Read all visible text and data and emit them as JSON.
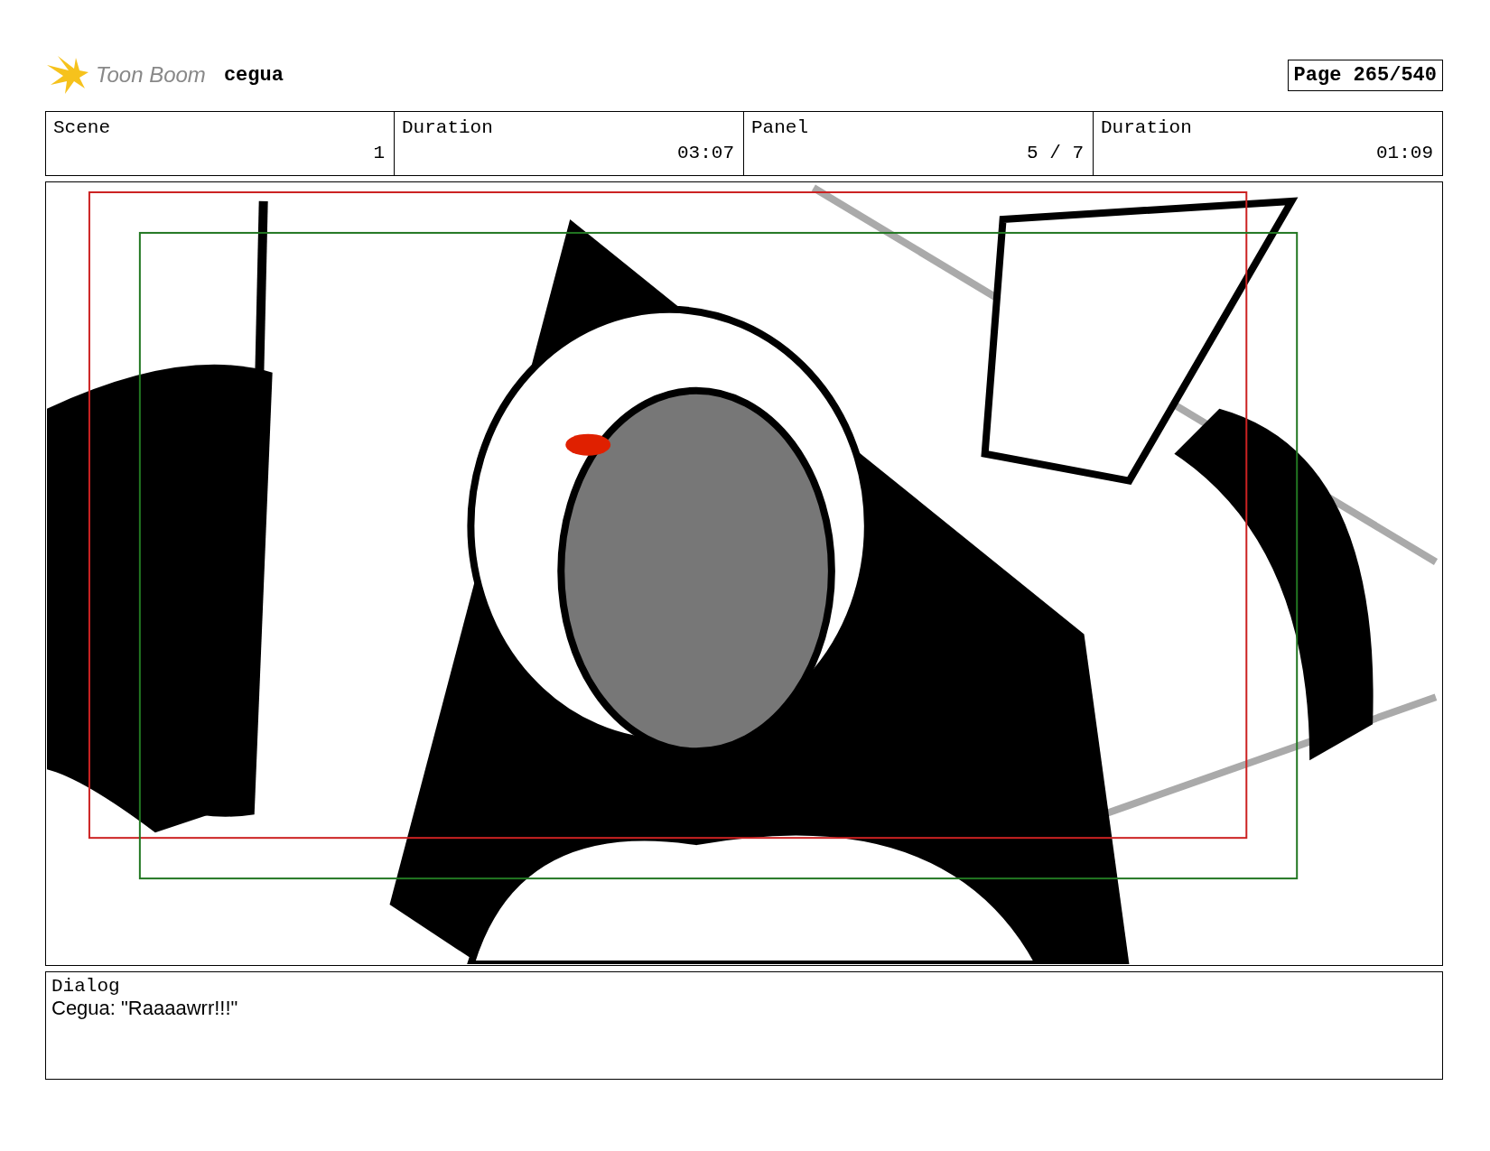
{
  "header": {
    "logo_text": "Toon Boom",
    "project": "cegua",
    "page": "Page 265/540"
  },
  "info": [
    {
      "label": "Scene",
      "value": "1"
    },
    {
      "label": "Duration",
      "value": "03:07"
    },
    {
      "label": "Panel",
      "value": "5 / 7"
    },
    {
      "label": "Duration",
      "value": "01:09"
    }
  ],
  "dialog": {
    "label": "Dialog",
    "text": "Cegua: \"Raaaawrr!!!\""
  }
}
